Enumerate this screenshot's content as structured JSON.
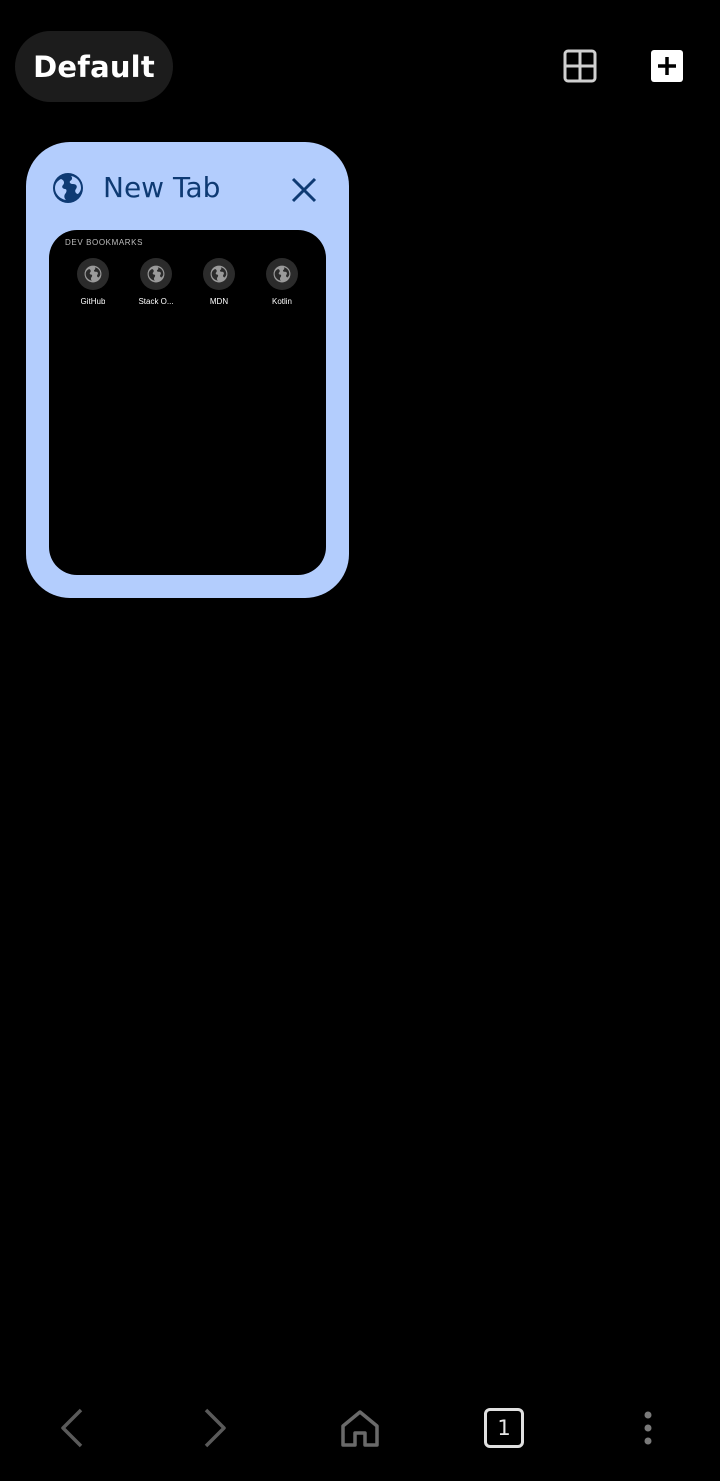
{
  "top_bar": {
    "group_label": "Default",
    "grid_icon": "grid-view-icon",
    "add_icon": "add-tab-icon"
  },
  "tabs": [
    {
      "title": "New Tab",
      "favicon": "globe-icon",
      "close_icon": "close-icon",
      "preview": {
        "heading": "DEV BOOKMARKS",
        "bookmarks": [
          {
            "label": "GitHub",
            "icon": "globe-icon"
          },
          {
            "label": "Stack O...",
            "icon": "globe-icon"
          },
          {
            "label": "MDN",
            "icon": "globe-icon"
          },
          {
            "label": "Kotlin",
            "icon": "globe-icon"
          }
        ]
      }
    }
  ],
  "bottom_nav": {
    "back_icon": "back-arrow-icon",
    "forward_icon": "forward-arrow-icon",
    "home_icon": "home-icon",
    "tab_count": "1",
    "menu_icon": "more-vert-icon"
  },
  "colors": {
    "background": "#000000",
    "card": "#b3cdfd",
    "card_text": "#0e3a73",
    "chip": "#1c1c1c"
  }
}
